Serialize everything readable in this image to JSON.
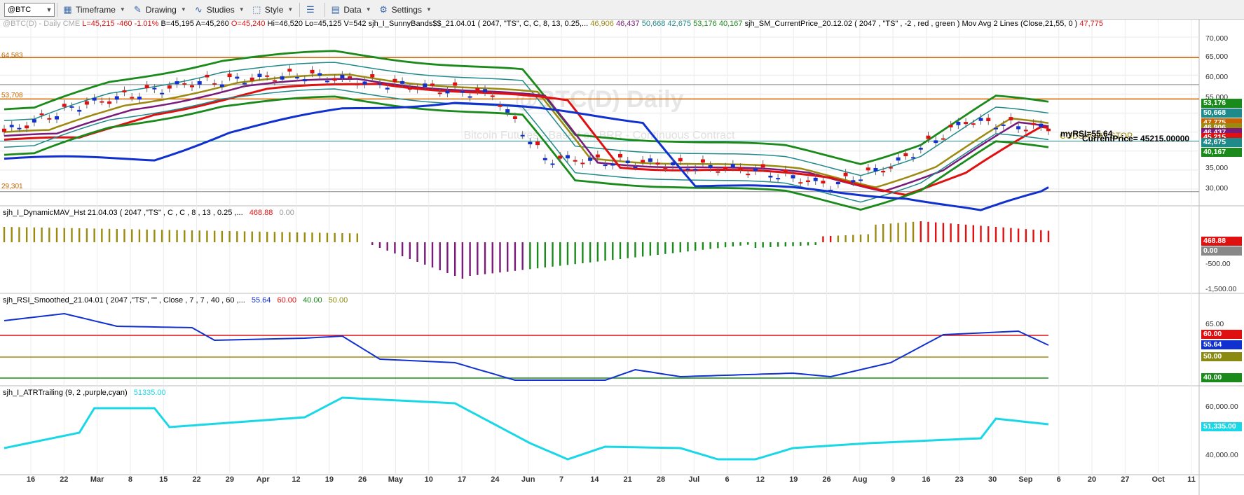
{
  "toolbar": {
    "symbol": "@BTC",
    "buttons": [
      {
        "label": "Timeframe",
        "icon": "calendar-icon"
      },
      {
        "label": "Drawing",
        "icon": "drawing-icon"
      },
      {
        "label": "Studies",
        "icon": "studies-icon"
      },
      {
        "label": "Style",
        "icon": "style-icon"
      },
      {
        "label": "Data",
        "icon": "data-icon"
      },
      {
        "label": "Settings",
        "icon": "gear-icon"
      }
    ]
  },
  "price_pane": {
    "symbol_label": "@BTC(D) - Daily",
    "exchange": "CME",
    "last": "L=45,215",
    "change": "-460",
    "change_pct": "-1.01%",
    "bid": "B=45,195",
    "ask": "A=45,260",
    "open": "O=45,240",
    "high": "Hi=46,520",
    "low": "Lo=45,125",
    "volume": "V=542",
    "study1": "sjh_I_SunnyBands$$_21.04.01 ( 2047, \"TS\", C, C,   8, 13, 0.25,...",
    "study1_vals": [
      "46,906",
      "46,437",
      "50,668",
      "42,675",
      "53,176",
      "40,167"
    ],
    "study2": "sjh_SM_CurrentPrice_20.12.02 ( 2047 , \"TS\" , -2 , red , green )",
    "study3": "Mov Avg 2 Lines (Close,21,55, 0 )",
    "study3_val": "47,775",
    "watermark_title": "@BTC(D) Daily",
    "watermark_sub": "Bitcoin Futures - Based on BRR - Continuous Contract",
    "hline_labels": [
      "64,583",
      "53,708",
      "29,301"
    ],
    "annot_rsi": "myRSI=55.64",
    "annot_price": "CurrentPrice= 45215.00000",
    "annot_stop": "CODSHORT STOP",
    "tags": [
      {
        "label": "53,176",
        "color": "#1a8a1a"
      },
      {
        "label": "50,668",
        "color": "#1f8a8a"
      },
      {
        "label": "47,775",
        "color": "#c86400"
      },
      {
        "label": "46,906",
        "color": "#9c8a10"
      },
      {
        "label": "46,437",
        "color": "#7a1a7a"
      },
      {
        "label": "45,215",
        "color": "#e01010"
      },
      {
        "label": "42,675",
        "color": "#1f8a8a"
      },
      {
        "label": "40,167",
        "color": "#1a8a1a"
      }
    ],
    "y_ticks": [
      "70,000",
      "65,000",
      "60,000",
      "55,000",
      "50,000",
      "45,000",
      "40,000",
      "35,000",
      "30,000"
    ]
  },
  "hist_pane": {
    "title": "sjh_I_DynamicMAV_Hst 21.04.03 ( 2047 ,\"TS\" , C , C ,  8 , 13 , 0.25 ,...",
    "val1": "468.88",
    "val2": "0.00",
    "tags": [
      {
        "label": "468.88",
        "color": "#e01010"
      },
      {
        "label": "0.00",
        "color": "#888888"
      }
    ],
    "y_ticks": [
      "-500.00",
      "-1,500.00"
    ]
  },
  "rsi_pane": {
    "title": "sjh_RSI_Smoothed_21.04.01 ( 2047 ,\"TS\", \"\" , Close , 7 , 7 , 40 , 60 ,...",
    "vals": [
      "55.64",
      "60.00",
      "40.00",
      "50.00"
    ],
    "tags": [
      {
        "label": "60.00",
        "color": "#e01010"
      },
      {
        "label": "55.64",
        "color": "#1030d0"
      },
      {
        "label": "50.00",
        "color": "#8a8a10"
      },
      {
        "label": "40.00",
        "color": "#1a8a1a"
      }
    ],
    "y_ticks": [
      "65.00"
    ]
  },
  "atr_pane": {
    "title": "sjh_I_ATRTrailing (9, 2 ,purple,cyan)",
    "val": "51335.00",
    "tags": [
      {
        "label": "51,335.00",
        "color": "#18d8e8"
      }
    ],
    "y_ticks": [
      "60,000.00",
      "40,000.00"
    ]
  },
  "x_axis": {
    "labels": [
      "16",
      "22",
      "Mar",
      "8",
      "15",
      "22",
      "29",
      "Apr",
      "12",
      "19",
      "26",
      "May",
      "10",
      "17",
      "24",
      "Jun",
      "7",
      "14",
      "21",
      "28",
      "Jul",
      "6",
      "12",
      "19",
      "26",
      "Aug",
      "9",
      "16",
      "23",
      "30",
      "Sep",
      "6",
      "20",
      "27",
      "Oct",
      "11"
    ]
  },
  "colors": {
    "red": "#e01010",
    "blue": "#1030d0",
    "green": "#1a8a1a",
    "teal": "#1f8a8a",
    "olive": "#9c8a10",
    "purple": "#7a1a7a",
    "orange": "#c86400",
    "cyan": "#18d8e8",
    "lime": "#44e044"
  }
}
